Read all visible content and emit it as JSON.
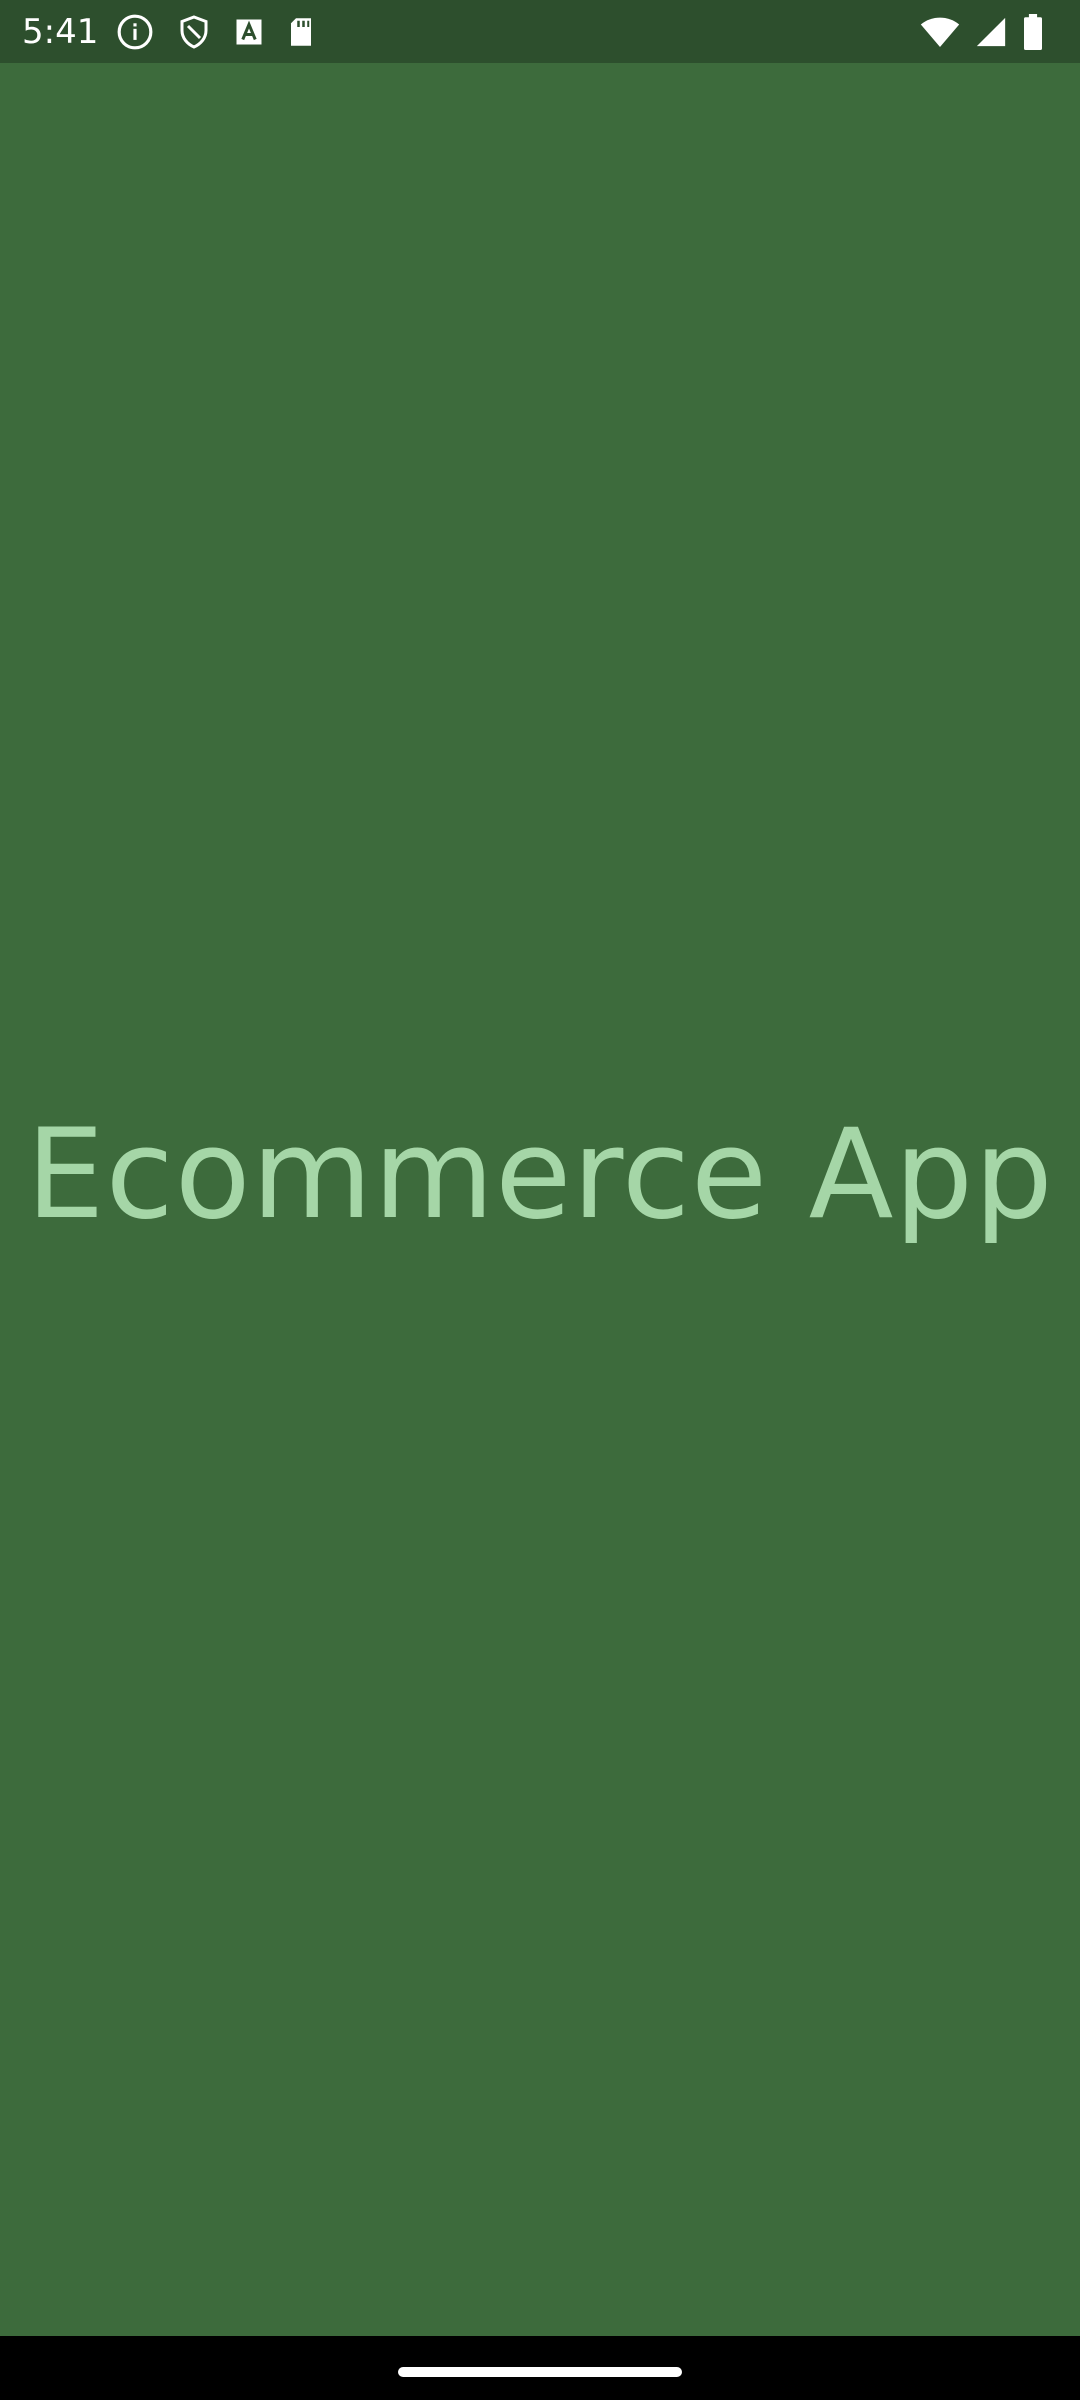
{
  "status_bar": {
    "time": "5:41",
    "left_icons": [
      "info-icon",
      "shield-icon",
      "text-a-icon",
      "sd-card-icon"
    ],
    "right_icons": [
      "wifi-icon",
      "signal-icon",
      "battery-icon"
    ]
  },
  "splash": {
    "title": "Ecommerce App"
  },
  "colors": {
    "background": "#3d6b3c",
    "status_bar": "#2d4f2d",
    "title_text": "#a5d6a7",
    "nav_bar": "#000000"
  }
}
